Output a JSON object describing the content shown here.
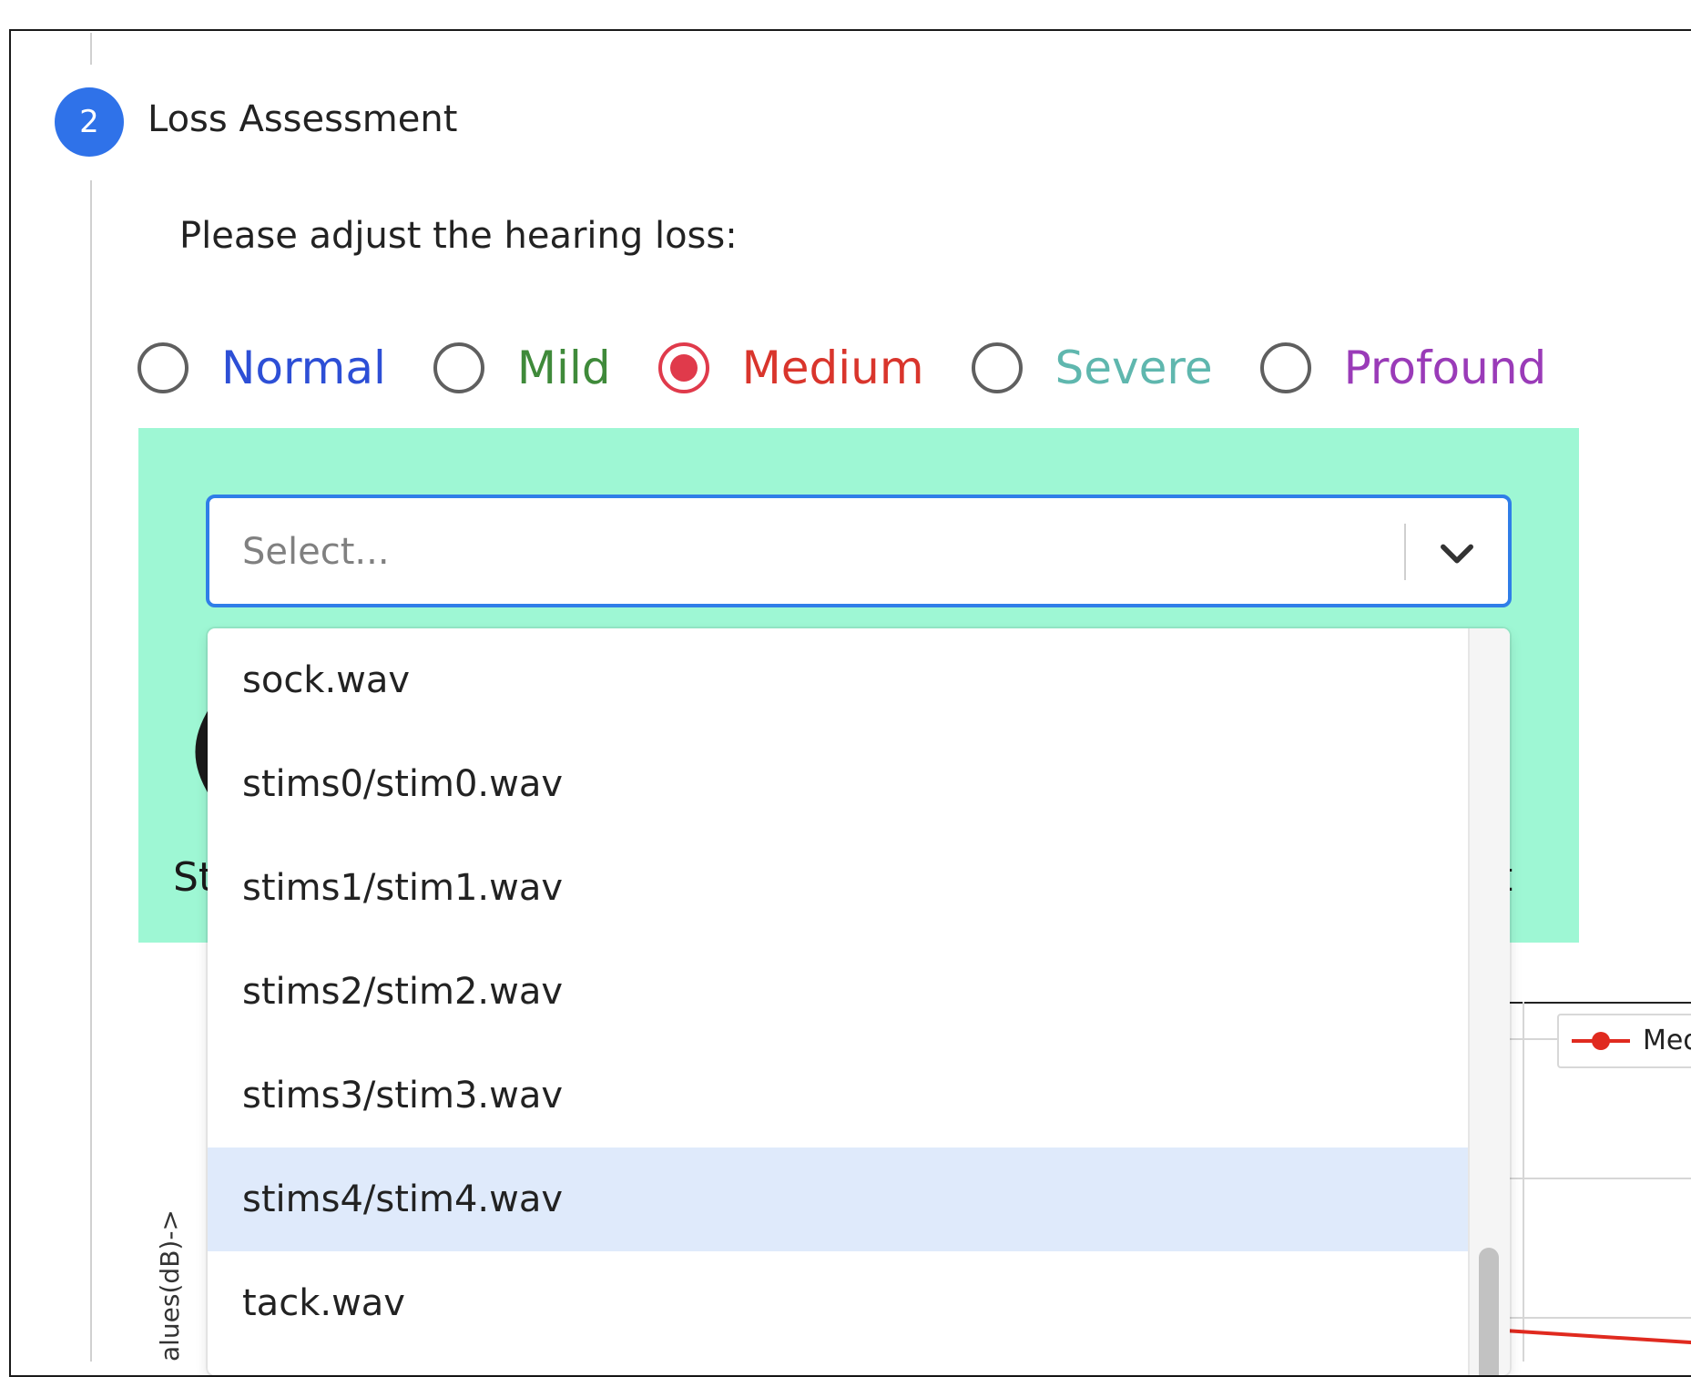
{
  "step": {
    "number": "2",
    "title": "Loss Assessment"
  },
  "prompt": "Please adjust the hearing loss:",
  "radio_options": [
    {
      "label": "Normal",
      "color": "#2d4fd6",
      "checked": false
    },
    {
      "label": "Mild",
      "color": "#3f8a3a",
      "checked": false
    },
    {
      "label": "Medium",
      "color": "#d9352c",
      "checked": true
    },
    {
      "label": "Severe",
      "color": "#5fb7ae",
      "checked": false
    },
    {
      "label": "Profound",
      "color": "#9a3bb8",
      "checked": false
    }
  ],
  "select": {
    "placeholder": "Select..."
  },
  "menu_items": [
    {
      "label": "sock.wav",
      "focused": false
    },
    {
      "label": "stims0/stim0.wav",
      "focused": false
    },
    {
      "label": "stims1/stim1.wav",
      "focused": false
    },
    {
      "label": "stims2/stim2.wav",
      "focused": false
    },
    {
      "label": "stims3/stim3.wav",
      "focused": false
    },
    {
      "label": "stims4/stim4.wav",
      "focused": true
    },
    {
      "label": "tack.wav",
      "focused": false
    }
  ],
  "background_fragments": {
    "left_text": "St",
    "right_text": "t",
    "glyph": "("
  },
  "chart": {
    "legend_label": "Med",
    "ylabel_fragment": "alues(dB)->",
    "series_color": "#e02a1f"
  },
  "colors": {
    "accent": "#2f72e9",
    "panel": "#9ef7d4",
    "focused_row": "#dfeafb"
  }
}
